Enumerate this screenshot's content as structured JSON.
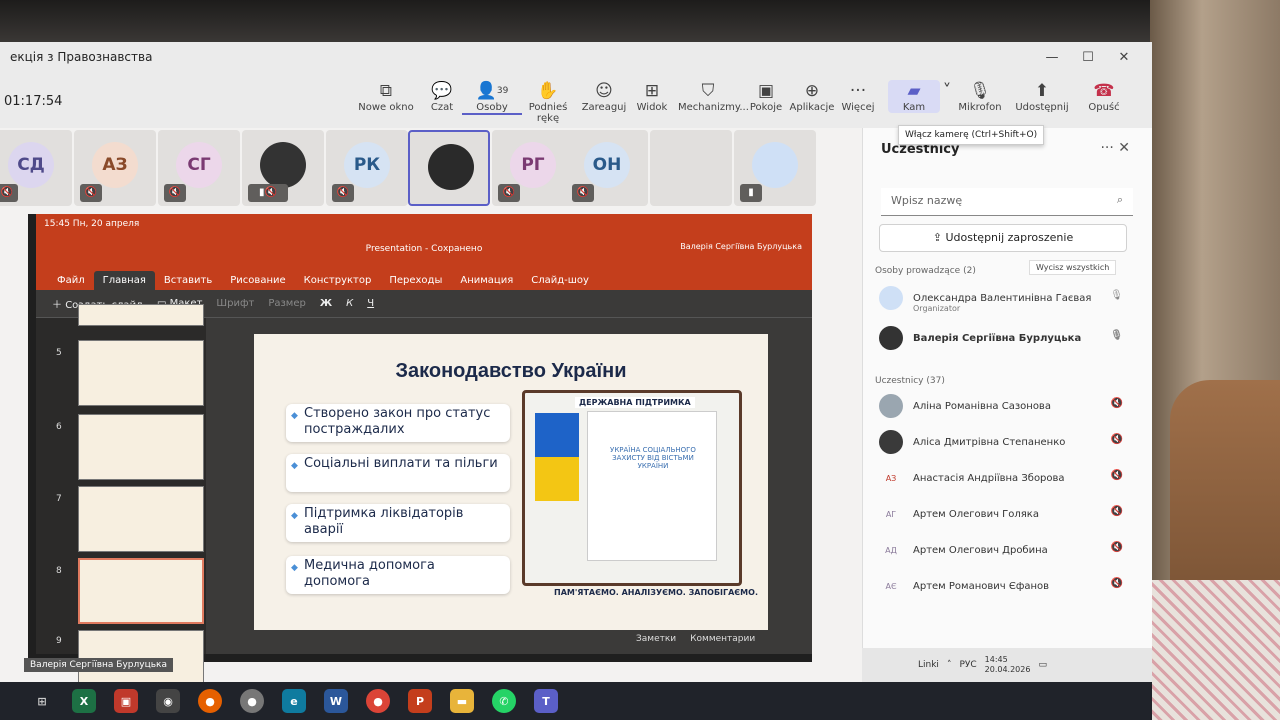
{
  "window": {
    "title": "екція з Правознавства",
    "timer": "01:17:54"
  },
  "toolbar": {
    "new_window": "Nowe okno",
    "chat": "Czat",
    "people": "Osoby",
    "people_count": "39",
    "raise_hand": "Podnieś rękę",
    "react": "Zareaguj",
    "view": "Widok",
    "mechanisms": "Mechanizmy...",
    "rooms": "Pokoje",
    "apps": "Aplikacje",
    "more": "Więcej",
    "camera": "Kam",
    "mic": "Mikrofon",
    "share": "Udostępnij",
    "leave": "Opuść"
  },
  "tooltip": "Włącz kamerę (Ctrl+Shift+O)",
  "tiles": [
    "СД",
    "АЗ",
    "СГ",
    "",
    "РК",
    "",
    "РГ",
    "ОН",
    "",
    ""
  ],
  "ppt": {
    "status_time": "15:45  Пн, 20 апреля",
    "file_title": "Presentation - Сохранено",
    "user": "Валерія Сергіївна Бурлуцька",
    "tabs": [
      "Файл",
      "Главная",
      "Вставить",
      "Рисование",
      "Конструктор",
      "Переходы",
      "Анимация",
      "Слайд-шоу"
    ],
    "ribbon": {
      "new_slide": "Создать слайд",
      "layout": "Макет",
      "font": "Шрифт",
      "size": "Размер",
      "bold": "Ж",
      "italic": "К",
      "underline": "Ч"
    },
    "slide_nums": [
      "5",
      "6",
      "7",
      "8",
      "9"
    ],
    "bottom": {
      "notes": "Заметки",
      "comments": "Комментарии"
    }
  },
  "slide": {
    "title": "Законодавство України",
    "bullets": [
      "Створено закон про статус постраждалих",
      "Соціальні виплати та пільги",
      "Підтримка ліквідаторів аварії",
      "Медична допомога допомога"
    ],
    "panel_title": "ДЕРЖАВНА ПІДТРИМКА",
    "doc_text": "УКРАЇНА СОЦІАЛЬНОГО ЗАХИСТУ ВІД ВІСТЬМИ УКРАЇНИ",
    "footer": "ПАМ'ЯТАЄМО. АНАЛІЗУЄМО. ЗАПОБІГАЄМО."
  },
  "presenter_label": "Валерія Сергіївна Бурлуцька",
  "side": {
    "title": "Uczestnicy",
    "search_placeholder": "Wpisz nazwę",
    "invite": "Udostępnij zaproszenie",
    "presenters_header": "Osoby prowadzące (2)",
    "mute_all": "Wycisz wszystkich",
    "presenters": [
      {
        "name": "Олександра Валентинівна Гаєвая",
        "role": "Organizator"
      },
      {
        "name": "Валерія Сергіївна Бурлуцька"
      }
    ],
    "attendees_header": "Uczestnicy (37)",
    "attendees": [
      "Аліна Романівна Сазонова",
      "Аліса Дмитрівна Степаненко",
      "Анастасія Андріївна Зборова",
      "Артем Олегович Голяка",
      "Артем Олегович Дробина",
      "Артем Романович Єфанов"
    ],
    "attendee_initials": [
      "",
      "",
      "АЗ",
      "АГ",
      "АД",
      "АЄ"
    ]
  },
  "sys": {
    "links": "Linki",
    "lang": "РУС",
    "time": "14:45",
    "date": "20.04.2026"
  }
}
